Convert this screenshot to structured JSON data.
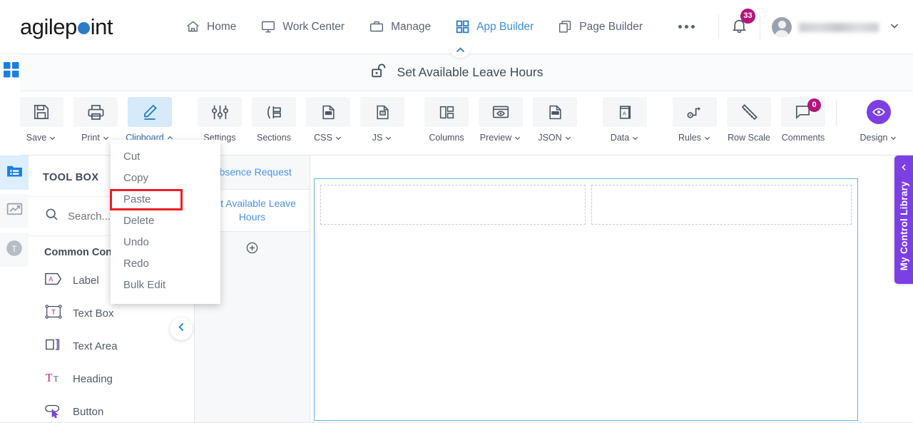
{
  "brand": {
    "name_part1": "agilep",
    "name_part2": "int",
    "dot_color": "#2b7cc4"
  },
  "topnav": {
    "items": [
      {
        "label": "Home",
        "icon": "home-icon",
        "active": false
      },
      {
        "label": "Work Center",
        "icon": "monitor-icon",
        "active": false
      },
      {
        "label": "Manage",
        "icon": "briefcase-icon",
        "active": false
      },
      {
        "label": "App Builder",
        "icon": "grid-icon",
        "active": true
      },
      {
        "label": "Page Builder",
        "icon": "pages-icon",
        "active": false
      }
    ],
    "more_label": "more-options",
    "notifications": {
      "count": "33",
      "badge_color": "#b3157d"
    },
    "user": {
      "name": "",
      "chevron": "chevron-down-icon"
    }
  },
  "titlebar": {
    "title": "Set Available Leave Hours",
    "icon": "unlock-icon",
    "collapse": "chevron-up-icon"
  },
  "ribbon": {
    "items": [
      {
        "label": "Save",
        "icon": "save-floppy-icon",
        "caret": "down",
        "active": false
      },
      {
        "label": "Print",
        "icon": "printer-icon",
        "caret": "down",
        "active": false
      },
      {
        "label": "Clipboard",
        "icon": "pencil-icon",
        "caret": "up",
        "active": true
      },
      {
        "label": "Settings",
        "icon": "sliders-icon",
        "caret": "",
        "active": false
      },
      {
        "label": "Sections",
        "icon": "sections-icon",
        "caret": "",
        "active": false
      },
      {
        "label": "CSS",
        "icon": "css-file-icon",
        "caret": "down",
        "active": false
      },
      {
        "label": "JS",
        "icon": "js-file-icon",
        "caret": "down",
        "active": false
      },
      {
        "label": "Columns",
        "icon": "columns-icon",
        "caret": "",
        "active": false
      },
      {
        "label": "Preview",
        "icon": "eye-window-icon",
        "caret": "down",
        "active": false
      },
      {
        "label": "JSON",
        "icon": "json-file-icon",
        "caret": "down",
        "active": false
      },
      {
        "label": "Data",
        "icon": "data-book-icon",
        "caret": "down",
        "active": false
      },
      {
        "label": "Rules",
        "icon": "rules-flow-icon",
        "caret": "down",
        "active": false
      },
      {
        "label": "Row Scale",
        "icon": "ruler-icon",
        "caret": "",
        "active": false
      },
      {
        "label": "Comments",
        "icon": "comment-bubble-icon",
        "caret": "",
        "active": false,
        "badge": "0"
      }
    ],
    "design": {
      "label": "Design",
      "icon": "eye-circle-icon",
      "caret": "down",
      "color": "#7b3fe4"
    }
  },
  "clipboard_menu": {
    "items": [
      {
        "label": "Cut",
        "highlighted": false
      },
      {
        "label": "Copy",
        "highlighted": false
      },
      {
        "label": "Paste",
        "highlighted": true
      },
      {
        "label": "Delete",
        "highlighted": false
      },
      {
        "label": "Undo",
        "highlighted": false
      },
      {
        "label": "Redo",
        "highlighted": false
      },
      {
        "label": "Bulk Edit",
        "highlighted": false
      }
    ],
    "highlight_color": "#ee1c25"
  },
  "rail": {
    "grid_icon": "app-grid-icon",
    "buttons": [
      {
        "icon": "toolbox-folder-icon",
        "active": true
      },
      {
        "icon": "chart-icon",
        "active": false
      },
      {
        "icon": "theme-t-icon",
        "active": false
      }
    ]
  },
  "toolbox": {
    "title": "TOOL BOX",
    "search_placeholder": "Search...",
    "search_value": "",
    "search_icon": "search-icon",
    "section_label": "Common Controls",
    "items": [
      {
        "label": "Label",
        "icon": "label-icon"
      },
      {
        "label": "Text Box",
        "icon": "textbox-icon"
      },
      {
        "label": "Text Area",
        "icon": "textarea-icon"
      },
      {
        "label": "Heading",
        "icon": "heading-icon"
      },
      {
        "label": "Button",
        "icon": "button-icon"
      }
    ],
    "collapse_icon": "chevron-left-icon"
  },
  "page_tabs": {
    "tabs": [
      {
        "label": "Absence Request",
        "active": false
      },
      {
        "label": "Set Available Leave Hours",
        "active": true
      }
    ],
    "add_label": "add-page-button"
  },
  "canvas": {
    "dropzones": [
      {
        "name": "drop-zone-left"
      },
      {
        "name": "drop-zone-right"
      }
    ]
  },
  "control_library": {
    "label": "My Control Library",
    "chevron": "chevron-left-icon",
    "color": "#7b3fe4"
  }
}
